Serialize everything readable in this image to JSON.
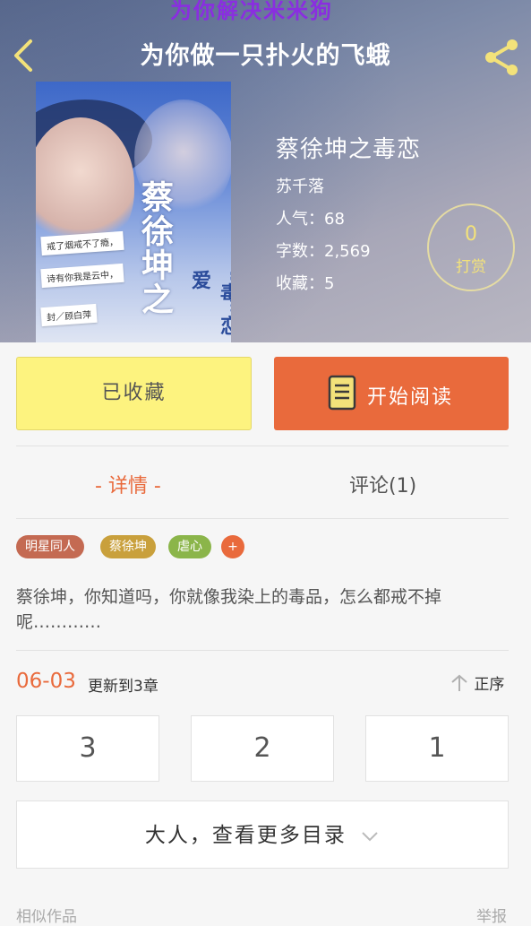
{
  "watermark": "为你解决米米狗",
  "header": {
    "title": "为你做一只扑火的飞蛾"
  },
  "cover": {
    "title": "蔡徐坤之",
    "subtitle": "“毒”恋爱",
    "lines": [
      "戒了烟戒不了瘾，",
      "诗有你我是云中，",
      "封／顾白萍"
    ]
  },
  "book": {
    "name": "蔡徐坤之毒恋",
    "author": "苏千落",
    "popularity": "人气：68",
    "word_count": "字数：2,569",
    "favorites": "收藏：5"
  },
  "tip": {
    "count": "0",
    "label": "打赏"
  },
  "actions": {
    "favorited_label": "已收藏",
    "read_label": "开始阅读"
  },
  "tabs": {
    "details": "- 详情 -",
    "comments": "评论(1)"
  },
  "tags": [
    {
      "label": "明星同人",
      "color": "#c46a52"
    },
    {
      "label": "蔡徐坤",
      "color": "#c9a03c"
    },
    {
      "label": "虐心",
      "color": "#8bb54a"
    },
    {
      "label": "+",
      "color": "#e96a3c"
    }
  ],
  "description": "蔡徐坤，你知道吗，你就像我染上的毒品，怎么都戒不掉呢…………",
  "update": {
    "date": "06-03",
    "text": "更新到3章",
    "order": "正序"
  },
  "chapters": [
    "3",
    "2",
    "1"
  ],
  "more_catalog": "大人，查看更多目录",
  "footer": {
    "similar": "相似作品",
    "report": "举报"
  },
  "colors": {
    "accent": "#e96a3c",
    "favorite_bg": "#fdf37f",
    "tip_gold": "#f3e27a"
  }
}
